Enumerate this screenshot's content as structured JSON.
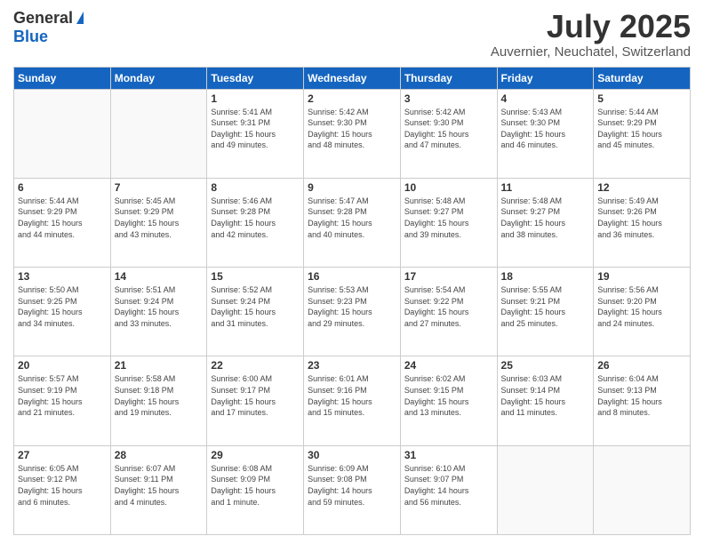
{
  "header": {
    "logo_general": "General",
    "logo_blue": "Blue",
    "month_year": "July 2025",
    "location": "Auvernier, Neuchatel, Switzerland"
  },
  "weekdays": [
    "Sunday",
    "Monday",
    "Tuesday",
    "Wednesday",
    "Thursday",
    "Friday",
    "Saturday"
  ],
  "weeks": [
    [
      {
        "day": "",
        "info": ""
      },
      {
        "day": "",
        "info": ""
      },
      {
        "day": "1",
        "info": "Sunrise: 5:41 AM\nSunset: 9:31 PM\nDaylight: 15 hours\nand 49 minutes."
      },
      {
        "day": "2",
        "info": "Sunrise: 5:42 AM\nSunset: 9:30 PM\nDaylight: 15 hours\nand 48 minutes."
      },
      {
        "day": "3",
        "info": "Sunrise: 5:42 AM\nSunset: 9:30 PM\nDaylight: 15 hours\nand 47 minutes."
      },
      {
        "day": "4",
        "info": "Sunrise: 5:43 AM\nSunset: 9:30 PM\nDaylight: 15 hours\nand 46 minutes."
      },
      {
        "day": "5",
        "info": "Sunrise: 5:44 AM\nSunset: 9:29 PM\nDaylight: 15 hours\nand 45 minutes."
      }
    ],
    [
      {
        "day": "6",
        "info": "Sunrise: 5:44 AM\nSunset: 9:29 PM\nDaylight: 15 hours\nand 44 minutes."
      },
      {
        "day": "7",
        "info": "Sunrise: 5:45 AM\nSunset: 9:29 PM\nDaylight: 15 hours\nand 43 minutes."
      },
      {
        "day": "8",
        "info": "Sunrise: 5:46 AM\nSunset: 9:28 PM\nDaylight: 15 hours\nand 42 minutes."
      },
      {
        "day": "9",
        "info": "Sunrise: 5:47 AM\nSunset: 9:28 PM\nDaylight: 15 hours\nand 40 minutes."
      },
      {
        "day": "10",
        "info": "Sunrise: 5:48 AM\nSunset: 9:27 PM\nDaylight: 15 hours\nand 39 minutes."
      },
      {
        "day": "11",
        "info": "Sunrise: 5:48 AM\nSunset: 9:27 PM\nDaylight: 15 hours\nand 38 minutes."
      },
      {
        "day": "12",
        "info": "Sunrise: 5:49 AM\nSunset: 9:26 PM\nDaylight: 15 hours\nand 36 minutes."
      }
    ],
    [
      {
        "day": "13",
        "info": "Sunrise: 5:50 AM\nSunset: 9:25 PM\nDaylight: 15 hours\nand 34 minutes."
      },
      {
        "day": "14",
        "info": "Sunrise: 5:51 AM\nSunset: 9:24 PM\nDaylight: 15 hours\nand 33 minutes."
      },
      {
        "day": "15",
        "info": "Sunrise: 5:52 AM\nSunset: 9:24 PM\nDaylight: 15 hours\nand 31 minutes."
      },
      {
        "day": "16",
        "info": "Sunrise: 5:53 AM\nSunset: 9:23 PM\nDaylight: 15 hours\nand 29 minutes."
      },
      {
        "day": "17",
        "info": "Sunrise: 5:54 AM\nSunset: 9:22 PM\nDaylight: 15 hours\nand 27 minutes."
      },
      {
        "day": "18",
        "info": "Sunrise: 5:55 AM\nSunset: 9:21 PM\nDaylight: 15 hours\nand 25 minutes."
      },
      {
        "day": "19",
        "info": "Sunrise: 5:56 AM\nSunset: 9:20 PM\nDaylight: 15 hours\nand 24 minutes."
      }
    ],
    [
      {
        "day": "20",
        "info": "Sunrise: 5:57 AM\nSunset: 9:19 PM\nDaylight: 15 hours\nand 21 minutes."
      },
      {
        "day": "21",
        "info": "Sunrise: 5:58 AM\nSunset: 9:18 PM\nDaylight: 15 hours\nand 19 minutes."
      },
      {
        "day": "22",
        "info": "Sunrise: 6:00 AM\nSunset: 9:17 PM\nDaylight: 15 hours\nand 17 minutes."
      },
      {
        "day": "23",
        "info": "Sunrise: 6:01 AM\nSunset: 9:16 PM\nDaylight: 15 hours\nand 15 minutes."
      },
      {
        "day": "24",
        "info": "Sunrise: 6:02 AM\nSunset: 9:15 PM\nDaylight: 15 hours\nand 13 minutes."
      },
      {
        "day": "25",
        "info": "Sunrise: 6:03 AM\nSunset: 9:14 PM\nDaylight: 15 hours\nand 11 minutes."
      },
      {
        "day": "26",
        "info": "Sunrise: 6:04 AM\nSunset: 9:13 PM\nDaylight: 15 hours\nand 8 minutes."
      }
    ],
    [
      {
        "day": "27",
        "info": "Sunrise: 6:05 AM\nSunset: 9:12 PM\nDaylight: 15 hours\nand 6 minutes."
      },
      {
        "day": "28",
        "info": "Sunrise: 6:07 AM\nSunset: 9:11 PM\nDaylight: 15 hours\nand 4 minutes."
      },
      {
        "day": "29",
        "info": "Sunrise: 6:08 AM\nSunset: 9:09 PM\nDaylight: 15 hours\nand 1 minute."
      },
      {
        "day": "30",
        "info": "Sunrise: 6:09 AM\nSunset: 9:08 PM\nDaylight: 14 hours\nand 59 minutes."
      },
      {
        "day": "31",
        "info": "Sunrise: 6:10 AM\nSunset: 9:07 PM\nDaylight: 14 hours\nand 56 minutes."
      },
      {
        "day": "",
        "info": ""
      },
      {
        "day": "",
        "info": ""
      }
    ]
  ]
}
